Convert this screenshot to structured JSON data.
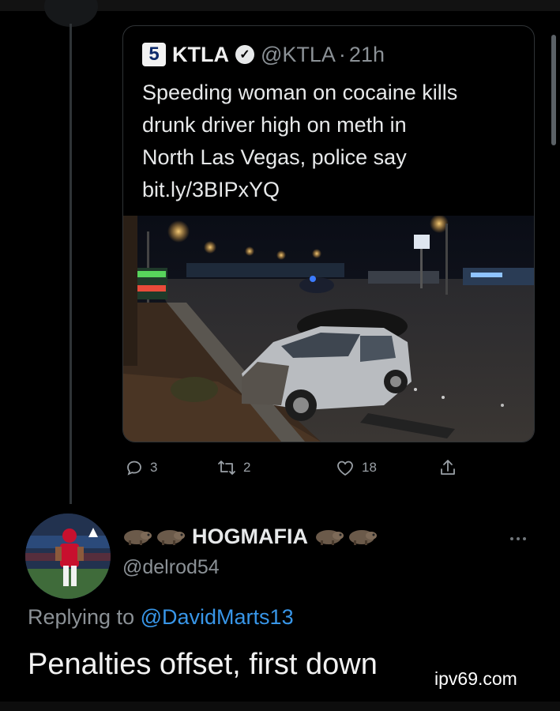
{
  "quoted_tweet": {
    "author_name": "KTLA",
    "channel_number": "5",
    "handle": "@KTLA",
    "separator": "·",
    "age": "21h",
    "text_lines": [
      "Speeding woman on cocaine kills",
      "drunk driver high on meth in",
      "North Las Vegas, police say",
      "bit.ly/3BIPxYQ"
    ]
  },
  "actions": {
    "replies": "3",
    "retweets": "2",
    "likes": "18"
  },
  "reply": {
    "display_name": "HOGMAFIA",
    "handle": "@delrod54",
    "replying_prefix": "Replying to",
    "replying_to": "@DavidMarts13",
    "text": "Penalties offset, first down"
  },
  "watermark": "ipv69.com",
  "icons": {
    "verified": "verified-check-icon",
    "reply": "reply-bubble-icon",
    "retweet": "retweet-icon",
    "like": "heart-icon",
    "share": "share-icon",
    "more": "more-dots-icon",
    "name_emoji": "hog-emoji-icon"
  },
  "colors": {
    "background": "#000000",
    "text": "#e7e9ea",
    "muted": "#8b9196",
    "link": "#3896e8",
    "border": "#2f3336"
  }
}
